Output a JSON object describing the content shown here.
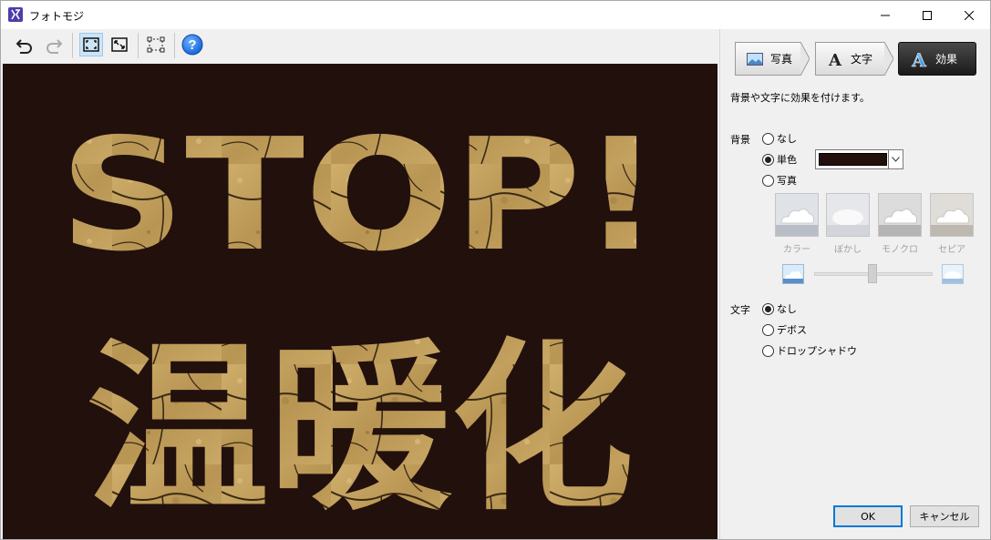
{
  "window": {
    "title": "フォトモジ"
  },
  "toolbar": {
    "undo_icon": "undo-icon",
    "redo_icon": "redo-icon",
    "fit_icon": "fit-window-icon",
    "actual_icon": "actual-size-icon",
    "select_icon": "selection-icon",
    "help_icon": "help-icon"
  },
  "canvas": {
    "background_color": "#22100d",
    "text_line1": "STOP!",
    "text_line2": "温暖化"
  },
  "steps": [
    {
      "label": "写真",
      "icon": "photo-icon",
      "active": false
    },
    {
      "label": "文字",
      "icon": "text-a-icon",
      "active": false
    },
    {
      "label": "効果",
      "icon": "effect-a-icon",
      "active": true
    }
  ],
  "panel": {
    "description": "背景や文字に効果を付けます。",
    "background_label": "背景",
    "bg_options": {
      "none": "なし",
      "solid": "単色",
      "photo": "写真"
    },
    "selected_color": "#22100d",
    "photo_options": [
      "カラー",
      "ぼかし",
      "モノクロ",
      "セピア"
    ],
    "text_label": "文字",
    "text_options": {
      "none": "なし",
      "emboss": "デボス",
      "shadow": "ドロップシャドウ"
    }
  },
  "buttons": {
    "ok": "OK",
    "cancel": "キャンセル"
  }
}
